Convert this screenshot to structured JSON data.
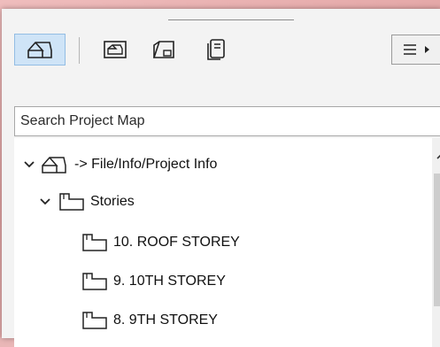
{
  "toolbar": {
    "buttons": [
      {
        "icon": "project-map-icon",
        "active": true
      },
      {
        "icon": "view-map-icon",
        "active": false
      },
      {
        "icon": "layout-book-icon",
        "active": false
      },
      {
        "icon": "publisher-sets-icon",
        "active": false
      }
    ],
    "menu_icon": "hamburger-menu-icon"
  },
  "search": {
    "placeholder": "Search Project Map"
  },
  "tree": {
    "root": {
      "label": "-> File/Info/Project Info",
      "expanded": true
    },
    "stories": {
      "label": "Stories",
      "expanded": true
    },
    "items": [
      {
        "label": "10. ROOF STOREY"
      },
      {
        "label": "9. 10TH STOREY"
      },
      {
        "label": "8. 9TH STOREY"
      }
    ]
  },
  "colors": {
    "active_button_bg": "#cfe4f7",
    "active_button_border": "#93bde4",
    "panel_bg": "#f3f3f3",
    "background": "#e9b7b7"
  }
}
